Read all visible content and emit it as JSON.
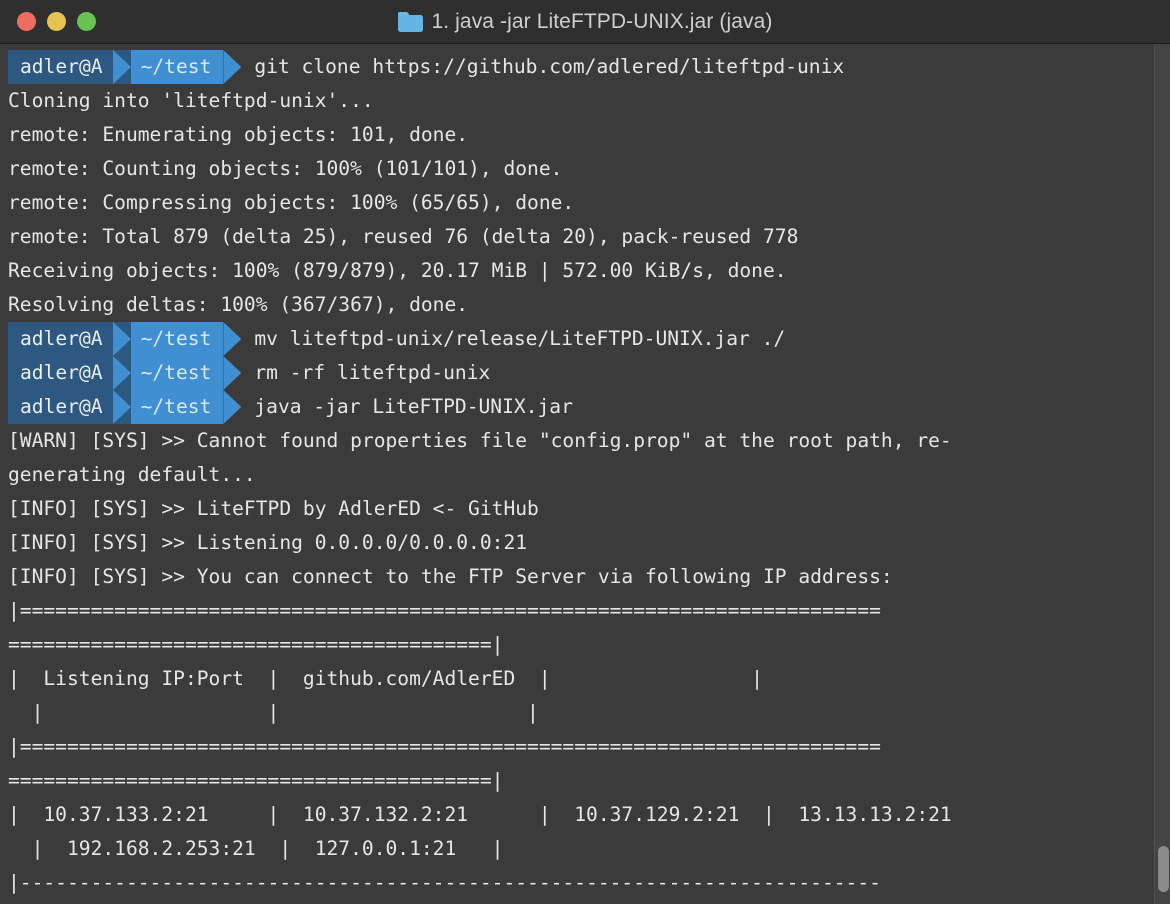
{
  "window": {
    "title": "1. java -jar LiteFTPD-UNIX.jar (java)",
    "folder_icon": "folder-icon",
    "traffic_lights": {
      "close": "close-button",
      "minimize": "minimize-button",
      "zoom": "zoom-button"
    },
    "colors": {
      "background": "#3b3b3b",
      "titlebar": "#2f2f2f",
      "text": "#e6e6e6",
      "prompt_user_bg": "#2d5882",
      "prompt_path_bg": "#3f8fd2",
      "close": "#ef6d60",
      "minimize": "#e7c252",
      "zoom": "#69c252",
      "scrollbar_thumb": "#8a8a8a"
    }
  },
  "prompt": {
    "user": "adler@A",
    "path": "~/test"
  },
  "terminal": {
    "lines": [
      {
        "type": "prompt",
        "command": "git clone https://github.com/adlered/liteftpd-unix"
      },
      {
        "type": "output",
        "text": "Cloning into 'liteftpd-unix'..."
      },
      {
        "type": "output",
        "text": "remote: Enumerating objects: 101, done."
      },
      {
        "type": "output",
        "text": "remote: Counting objects: 100% (101/101), done."
      },
      {
        "type": "output",
        "text": "remote: Compressing objects: 100% (65/65), done."
      },
      {
        "type": "output",
        "text": "remote: Total 879 (delta 25), reused 76 (delta 20), pack-reused 778"
      },
      {
        "type": "output",
        "text": "Receiving objects: 100% (879/879), 20.17 MiB | 572.00 KiB/s, done."
      },
      {
        "type": "output",
        "text": "Resolving deltas: 100% (367/367), done."
      },
      {
        "type": "prompt",
        "command": "mv liteftpd-unix/release/LiteFTPD-UNIX.jar ./"
      },
      {
        "type": "prompt",
        "command": "rm -rf liteftpd-unix"
      },
      {
        "type": "prompt",
        "command": "java -jar LiteFTPD-UNIX.jar"
      },
      {
        "type": "output",
        "text": "[WARN] [SYS] >> Cannot found properties file \"config.prop\" at the root path, re-"
      },
      {
        "type": "output",
        "text": "generating default..."
      },
      {
        "type": "output",
        "text": "[INFO] [SYS] >> LiteFTPD by AdlerED <- GitHub"
      },
      {
        "type": "output",
        "text": "[INFO] [SYS] >> Listening 0.0.0.0/0.0.0.0:21"
      },
      {
        "type": "output",
        "text": "[INFO] [SYS] >> You can connect to the FTP Server via following IP address:"
      },
      {
        "type": "output",
        "text": "|========================================================================="
      },
      {
        "type": "output",
        "text": "=========================================|"
      },
      {
        "type": "output",
        "text": "|  Listening IP:Port  |  github.com/AdlerED  |                 |"
      },
      {
        "type": "output",
        "text": "  |                   |                     |"
      },
      {
        "type": "output",
        "text": "|========================================================================="
      },
      {
        "type": "output",
        "text": "=========================================|"
      },
      {
        "type": "output",
        "text": "|  10.37.133.2:21     |  10.37.132.2:21      |  10.37.129.2:21  |  13.13.13.2:21"
      },
      {
        "type": "output",
        "text": "  |  192.168.2.253:21  |  127.0.0.1:21   |"
      },
      {
        "type": "output",
        "text": "|-------------------------------------------------------------------------"
      }
    ]
  },
  "scrollbar": {
    "name": "vertical-scrollbar",
    "thumb_position": "bottom"
  }
}
